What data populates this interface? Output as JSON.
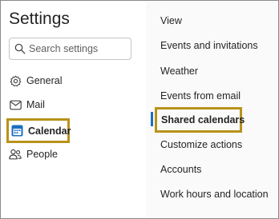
{
  "settings": {
    "title": "Settings",
    "search": {
      "placeholder": "Search settings"
    },
    "nav": [
      {
        "label": "General",
        "icon": "gear-icon"
      },
      {
        "label": "Mail",
        "icon": "mail-icon"
      },
      {
        "label": "Calendar",
        "icon": "calendar-icon",
        "selected": true
      },
      {
        "label": "People",
        "icon": "people-icon"
      }
    ]
  },
  "calendar_settings": {
    "items": [
      {
        "label": "View"
      },
      {
        "label": "Events and invitations"
      },
      {
        "label": "Weather"
      },
      {
        "label": "Events from email"
      },
      {
        "label": "Shared calendars",
        "selected": true
      },
      {
        "label": "Customize actions"
      },
      {
        "label": "Accounts"
      },
      {
        "label": "Work hours and location"
      }
    ]
  },
  "colors": {
    "highlight_border": "#b8921a",
    "selected_indicator": "#1b6ec2",
    "calendar_icon": "#1b6ec2"
  }
}
